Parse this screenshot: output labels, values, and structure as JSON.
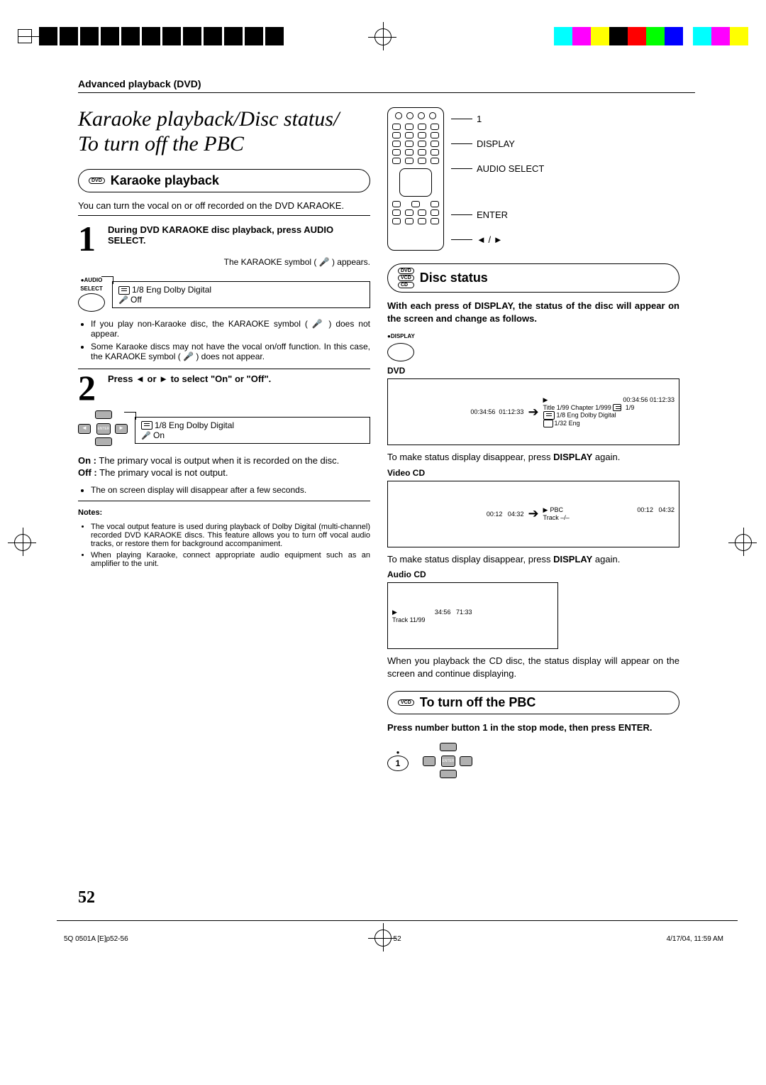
{
  "header": {
    "section_label": "Advanced playback (DVD)"
  },
  "title": {
    "line1": "Karaoke playback/Disc status/",
    "line2": "To turn off the PBC"
  },
  "remote_labels": {
    "one": "1",
    "display": "DISPLAY",
    "audio_select": "AUDIO SELECT",
    "enter": "ENTER",
    "arrows": "◄ / ►"
  },
  "karaoke": {
    "bar_title": "Karaoke playback",
    "intro": "You can turn the vocal on or off recorded on the DVD KARAOKE.",
    "step1_text": "During DVD KARAOKE disc playback, press AUDIO SELECT.",
    "step1_sub": "The KARAOKE symbol ( 🎤 ) appears.",
    "btn_label_line1": "AUDIO",
    "btn_label_line2": "SELECT",
    "osd1_line1": "1/8 Eng Dolby Digital",
    "osd1_line2": "Off",
    "bullets1": [
      "If you play non-Karaoke disc, the KARAOKE symbol ( 🎤 ) does not appear.",
      "Some Karaoke discs may not have the vocal on/off function. In this case, the KARAOKE symbol ( 🎤 ) does not appear."
    ],
    "step2_text": "Press ◄ or ► to select \"On\" or \"Off\".",
    "osd2_line1": "1/8 Eng Dolby Digital",
    "osd2_line2": "On",
    "on_label": "On :",
    "on_desc": "The primary vocal is output when it is recorded on the disc.",
    "off_label": "Off :",
    "off_desc": "The primary vocal is not output.",
    "bullet_after": "The on screen display will disappear after a few seconds.",
    "notes_hdr": "Notes:",
    "notes": [
      "The vocal output feature is used during playback of Dolby Digital (multi-channel) recorded DVD KARAOKE discs. This feature allows you to turn off vocal audio tracks, or restore them for background accompaniment.",
      "When playing Karaoke, connect appropriate audio equipment such as an amplifier to the unit."
    ]
  },
  "disc_status": {
    "bar_title": "Disc status",
    "intro": "With each press of DISPLAY, the status of the disc will appear on the screen and change as follows.",
    "display_btn_label": "DISPLAY",
    "dvd_hdr": "DVD",
    "dvd_left_time1": "00:34:56",
    "dvd_left_time2": "01:12:33",
    "dvd_right_time": "00:34:56  01:12:33",
    "dvd_title_line": "Title      1/99   Chapter  1/999",
    "dvd_audio_badge": "1/9",
    "dvd_audio_line": "1/8  Eng Dolby Digital",
    "dvd_sub_line": "1/32  Eng",
    "dvd_note": "To make status display disappear, press DISPLAY again.",
    "vcd_hdr": "Video CD",
    "vcd_left_t1": "00:12",
    "vcd_left_t2": "04:32",
    "vcd_right_pbc": "PBC",
    "vcd_right_t1": "00:12",
    "vcd_right_t2": "04:32",
    "vcd_track": "Track   –/–",
    "vcd_note": "To make status display disappear, press DISPLAY again.",
    "acd_hdr": "Audio CD",
    "acd_t1": "34:56",
    "acd_t2": "71:33",
    "acd_track": "Track 11/99",
    "acd_note": "When you playback the CD disc, the status display will appear on the screen and continue displaying."
  },
  "pbc": {
    "bar_title": "To turn off the PBC",
    "instruction": "Press number button 1 in the stop mode, then press ENTER.",
    "enter_label": "ENTER"
  },
  "page_number": "52",
  "footer": {
    "file": "5Q  0501A [E]p52-56",
    "page": "52",
    "datetime": "4/17/04, 11:59 AM"
  }
}
